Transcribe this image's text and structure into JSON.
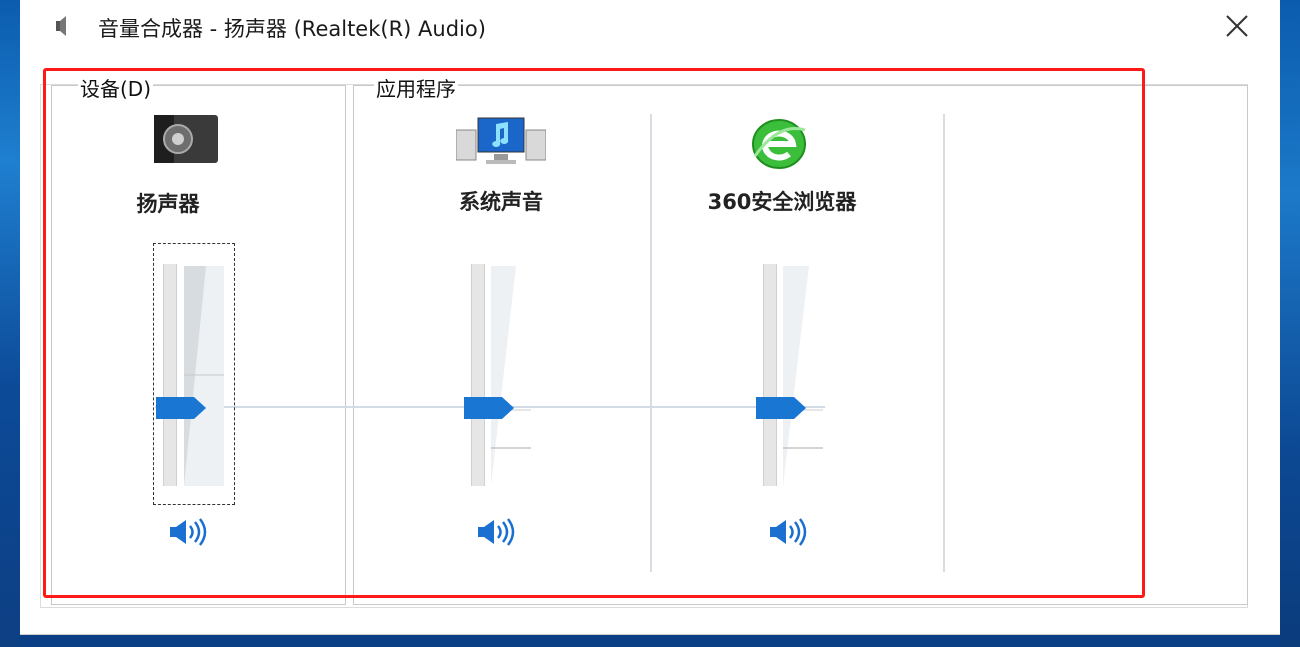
{
  "window": {
    "title": "音量合成器 - 扬声器 (Realtek(R) Audio)"
  },
  "device_group": {
    "label": "设备(D)",
    "channel": {
      "name": "扬声器",
      "icon": "speaker-device-icon",
      "volume_percent": 40
    }
  },
  "apps_group": {
    "label": "应用程序",
    "channels": [
      {
        "name": "系统声音",
        "icon": "system-sounds-icon",
        "volume_percent": 40
      },
      {
        "name": "360安全浏览器",
        "icon": "360-browser-icon",
        "volume_percent": 40
      }
    ]
  },
  "colors": {
    "thumb": "#1976d2",
    "highlight": "#ff1a1a",
    "mute_icon": "#1a6fd0"
  }
}
